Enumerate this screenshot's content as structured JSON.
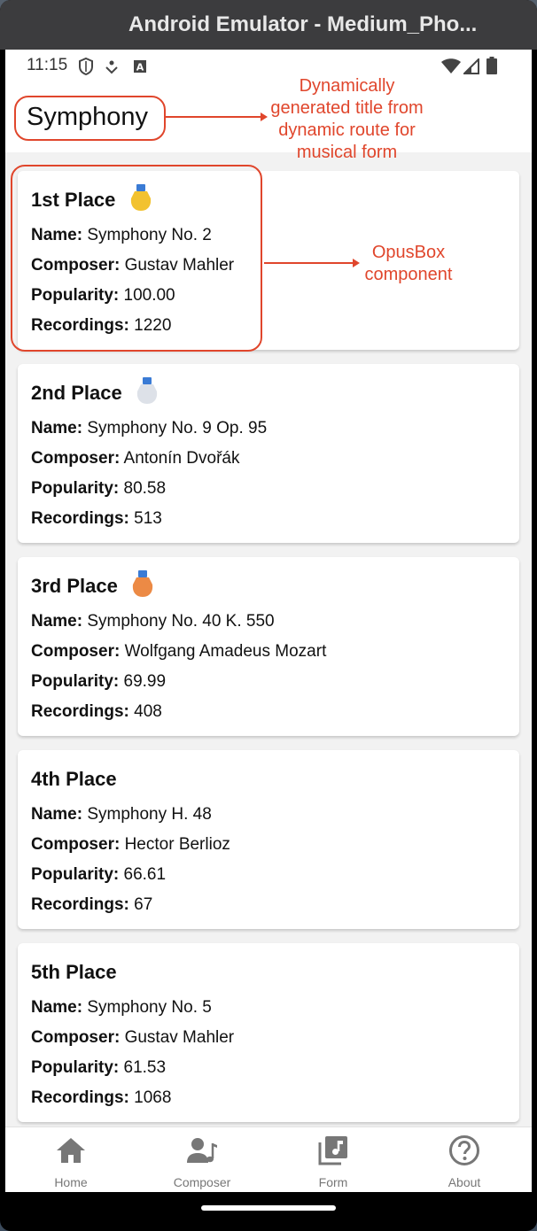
{
  "window": {
    "title": "Android Emulator - Medium_Pho..."
  },
  "status_bar": {
    "time": "11:15"
  },
  "header": {
    "title": "Symphony"
  },
  "annotations": {
    "title_note": "Dynamically generated title from dynamic route for musical form",
    "title_note_lines": [
      "Dynamically",
      "generated title from",
      "dynamic route for",
      "musical form"
    ],
    "component_note_lines": [
      "OpusBox",
      "component"
    ],
    "color": "#e0462c"
  },
  "labels": {
    "name": "Name:",
    "composer": "Composer:",
    "popularity": "Popularity:",
    "recordings": "Recordings:"
  },
  "opuses": [
    {
      "place": "1st Place",
      "medal": "gold-medal-icon",
      "medal_color": "#f2c230",
      "name": "Symphony No. 2",
      "composer": "Gustav Mahler",
      "popularity": "100.00",
      "recordings": "1220"
    },
    {
      "place": "2nd Place",
      "medal": "silver-medal-icon",
      "medal_color": "#dde1e8",
      "name": "Symphony No. 9 Op. 95",
      "composer": "Antonín Dvořák",
      "popularity": "80.58",
      "recordings": "513"
    },
    {
      "place": "3rd Place",
      "medal": "bronze-medal-icon",
      "medal_color": "#ec8a45",
      "name": "Symphony No. 40 K. 550",
      "composer": "Wolfgang Amadeus Mozart",
      "popularity": "69.99",
      "recordings": "408"
    },
    {
      "place": "4th Place",
      "name": "Symphony H. 48",
      "composer": "Hector Berlioz",
      "popularity": "66.61",
      "recordings": "67"
    },
    {
      "place": "5th Place",
      "name": "Symphony No. 5",
      "composer": "Gustav Mahler",
      "popularity": "61.53",
      "recordings": "1068"
    }
  ],
  "nav": [
    {
      "label": "Home",
      "icon": "home-icon"
    },
    {
      "label": "Composer",
      "icon": "composer-icon"
    },
    {
      "label": "Form",
      "icon": "music-library-icon"
    },
    {
      "label": "About",
      "icon": "help-circle-icon"
    }
  ]
}
